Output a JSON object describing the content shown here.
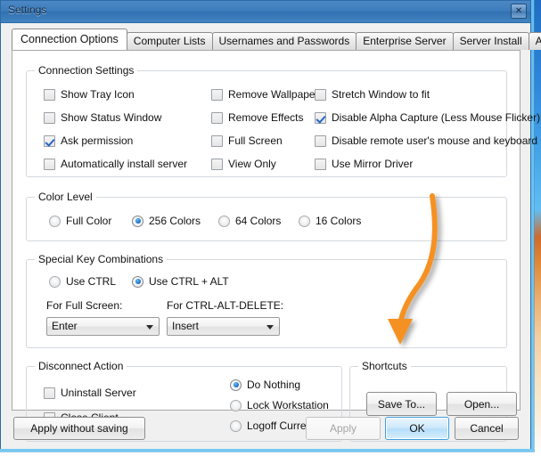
{
  "window": {
    "title": "Settings",
    "close_label": "✕"
  },
  "tabs": [
    {
      "label": "Connection Options",
      "active": true
    },
    {
      "label": "Computer Lists",
      "active": false
    },
    {
      "label": "Usernames and Passwords",
      "active": false
    },
    {
      "label": "Enterprise Server",
      "active": false
    },
    {
      "label": "Server Install",
      "active": false
    },
    {
      "label": "About",
      "active": false
    }
  ],
  "connection_settings": {
    "title": "Connection Settings",
    "column1": [
      {
        "label": "Show Tray Icon",
        "checked": false
      },
      {
        "label": "Show Status Window",
        "checked": false
      },
      {
        "label": "Ask permission",
        "checked": true
      },
      {
        "label": "Automatically install server",
        "checked": false
      }
    ],
    "column2": [
      {
        "label": "Remove Wallpaper",
        "checked": false
      },
      {
        "label": "Remove Effects",
        "checked": false
      },
      {
        "label": "Full Screen",
        "checked": false
      },
      {
        "label": "View Only",
        "checked": false
      }
    ],
    "column3": [
      {
        "label": "Stretch Window to fit",
        "checked": false
      },
      {
        "label": "Disable Alpha Capture (Less Mouse Flicker)",
        "checked": true
      },
      {
        "label": "Disable remote user's mouse and keyboard",
        "checked": false
      },
      {
        "label": "Use Mirror Driver",
        "checked": false
      }
    ]
  },
  "color_level": {
    "title": "Color Level",
    "options": [
      {
        "label": "Full Color",
        "selected": false
      },
      {
        "label": "256 Colors",
        "selected": true
      },
      {
        "label": "64 Colors",
        "selected": false
      },
      {
        "label": "16 Colors",
        "selected": false
      }
    ]
  },
  "special_keys": {
    "title": "Special Key Combinations",
    "options": [
      {
        "label": "Use CTRL",
        "selected": false
      },
      {
        "label": "Use CTRL + ALT",
        "selected": true
      }
    ],
    "full_screen_label": "For Full Screen:",
    "full_screen_value": "Enter",
    "ctrl_alt_delete_label": "For CTRL-ALT-DELETE:",
    "ctrl_alt_delete_value": "Insert"
  },
  "disconnect_action": {
    "title": "Disconnect Action",
    "checkboxes": [
      {
        "label": "Uninstall Server",
        "checked": false
      },
      {
        "label": "Close Client",
        "checked": false
      }
    ],
    "radios": [
      {
        "label": "Do Nothing",
        "selected": true
      },
      {
        "label": "Lock Workstation",
        "selected": false
      },
      {
        "label": "Logoff Current User",
        "selected": false
      }
    ]
  },
  "shortcuts": {
    "title": "Shortcuts",
    "save_to_label": "Save To...",
    "open_label": "Open..."
  },
  "footer": {
    "apply_without_saving_label": "Apply without saving",
    "apply_label": "Apply",
    "ok_label": "OK",
    "cancel_label": "Cancel"
  },
  "annotation": {
    "arrow_color": "#F59121",
    "points_to": "Save To..."
  }
}
